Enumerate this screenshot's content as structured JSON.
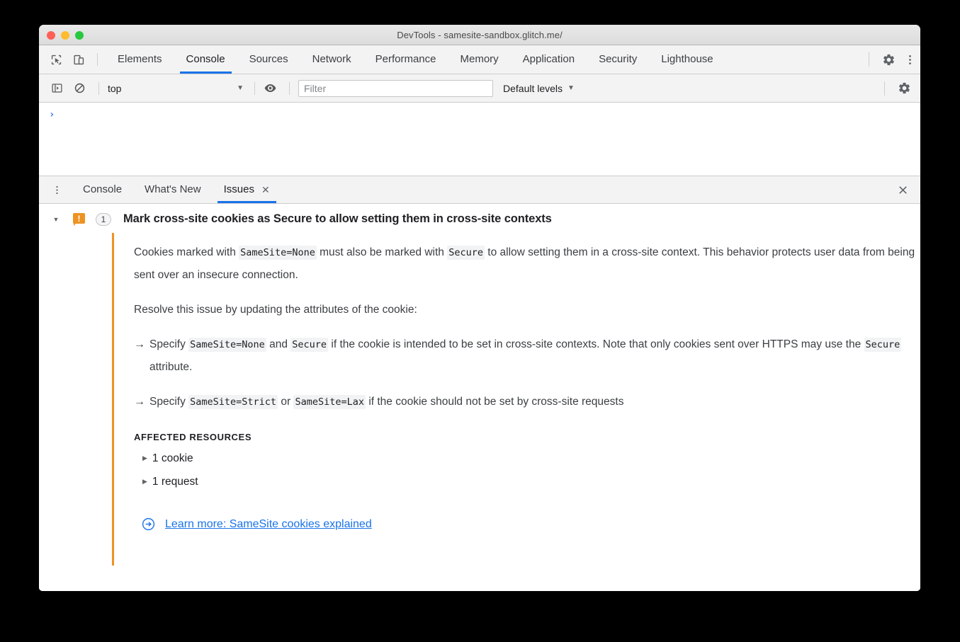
{
  "window": {
    "title": "DevTools - samesite-sandbox.glitch.me/",
    "traffic_lights": [
      "close",
      "minimize",
      "zoom"
    ]
  },
  "main_toolbar": {
    "inspect_icon": "inspect-element-icon",
    "device_icon": "device-toolbar-icon",
    "tabs": [
      {
        "label": "Elements",
        "active": false
      },
      {
        "label": "Console",
        "active": true
      },
      {
        "label": "Sources",
        "active": false
      },
      {
        "label": "Network",
        "active": false
      },
      {
        "label": "Performance",
        "active": false
      },
      {
        "label": "Memory",
        "active": false
      },
      {
        "label": "Application",
        "active": false
      },
      {
        "label": "Security",
        "active": false
      },
      {
        "label": "Lighthouse",
        "active": false
      }
    ],
    "settings_icon": "gear-icon",
    "more_icon": "kebab-menu-icon"
  },
  "console_toolbar": {
    "sidebar_icon": "console-sidebar-icon",
    "clear_icon": "clear-console-icon",
    "context": "top",
    "context_caret": "▼",
    "eye_icon": "live-expression-icon",
    "filter_placeholder": "Filter",
    "filter_value": "",
    "levels_label": "Default levels",
    "levels_caret": "▼",
    "settings_icon": "gear-icon"
  },
  "console_output": {
    "prompt": "›"
  },
  "drawer": {
    "more_icon": "kebab-menu-icon",
    "tabs": [
      {
        "label": "Console",
        "active": false,
        "closable": false
      },
      {
        "label": "What's New",
        "active": false,
        "closable": false
      },
      {
        "label": "Issues",
        "active": true,
        "closable": true,
        "close_glyph": "✕"
      }
    ],
    "close_glyph": "✕"
  },
  "issue": {
    "expand_glyph": "▼",
    "severity_icon": "warning-icon",
    "severity_glyph": "!",
    "count": "1",
    "title": "Mark cross-site cookies as Secure to allow setting them in cross-site contexts",
    "accent_color": "#ee9322",
    "paragraph1": {
      "p1": "Cookies marked with ",
      "c1": "SameSite=None",
      "p2": " must also be marked with ",
      "c2": "Secure",
      "p3": " to allow setting them in a cross-site context. This behavior protects user data from being sent over an insecure connection."
    },
    "paragraph2": "Resolve this issue by updating the attributes of the cookie:",
    "bullet1": {
      "arrow": "→",
      "p1": "Specify ",
      "c1": "SameSite=None",
      "p2": " and ",
      "c2": "Secure",
      "p3": " if the cookie is intended to be set in cross-site contexts. Note that only cookies sent over HTTPS may use the ",
      "c3": "Secure",
      "p4": " attribute."
    },
    "bullet2": {
      "arrow": "→",
      "p1": "Specify ",
      "c1": "SameSite=Strict",
      "p2": " or ",
      "c2": "SameSite=Lax",
      "p3": " if the cookie should not be set by cross-site requests"
    },
    "affected_resources_label": "AFFECTED RESOURCES",
    "resources": [
      {
        "glyph": "▶",
        "label": "1 cookie"
      },
      {
        "glyph": "▶",
        "label": "1 request"
      }
    ],
    "learn_more_icon": "external-link-circle-arrow-icon",
    "learn_more_label": "Learn more: SameSite cookies explained",
    "link_color": "#1a73e8"
  }
}
